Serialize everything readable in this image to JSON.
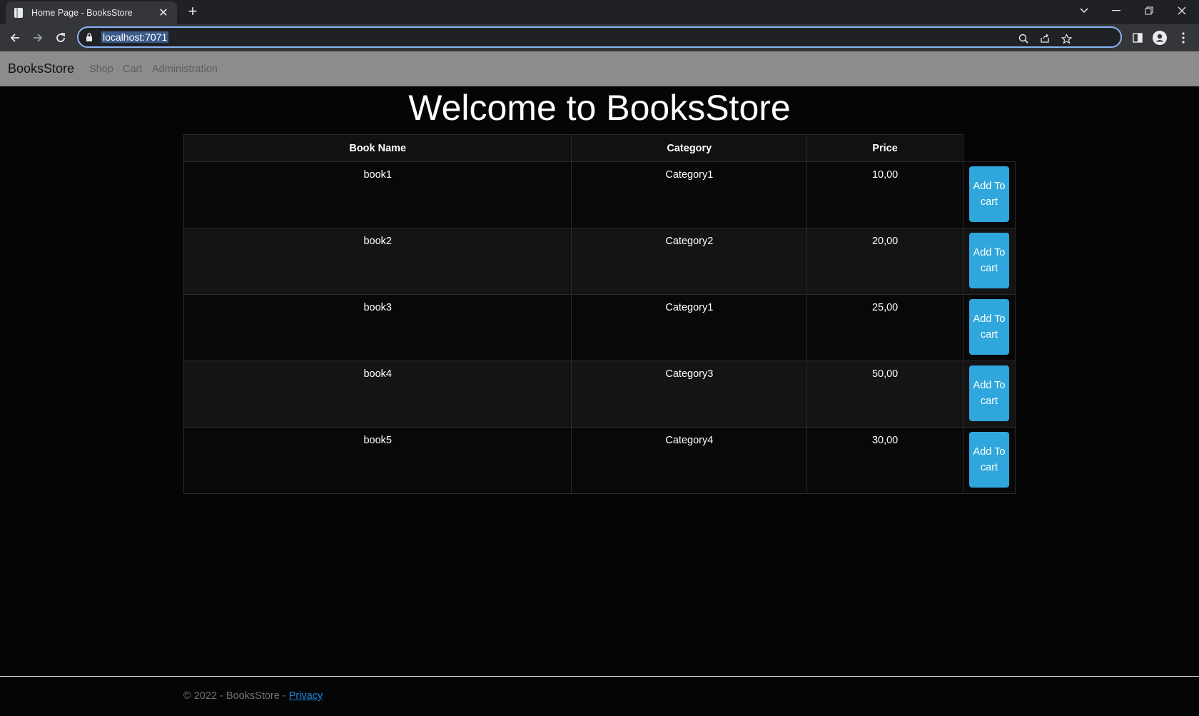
{
  "browser": {
    "tab_title": "Home Page - BooksStore",
    "url": "localhost:7071"
  },
  "site": {
    "brand": "BooksStore",
    "nav": [
      "Shop",
      "Cart",
      "Administration"
    ]
  },
  "main": {
    "heading": "Welcome to BooksStore",
    "table": {
      "headers": [
        "Book Name",
        "Category",
        "Price",
        ""
      ],
      "rows": [
        {
          "name": "book1",
          "category": "Category1",
          "price": "10,00"
        },
        {
          "name": "book2",
          "category": "Category2",
          "price": "20,00"
        },
        {
          "name": "book3",
          "category": "Category1",
          "price": "25,00"
        },
        {
          "name": "book4",
          "category": "Category3",
          "price": "50,00"
        },
        {
          "name": "book5",
          "category": "Category4",
          "price": "30,00"
        }
      ],
      "add_label": "Add To cart"
    }
  },
  "footer": {
    "text": "© 2022 - BooksStore - ",
    "privacy": "Privacy"
  },
  "colors": {
    "accent_button": "#2fa7dc",
    "navbar": "#8c8c8c",
    "page_bg": "#050505",
    "link": "#1e88e5"
  }
}
